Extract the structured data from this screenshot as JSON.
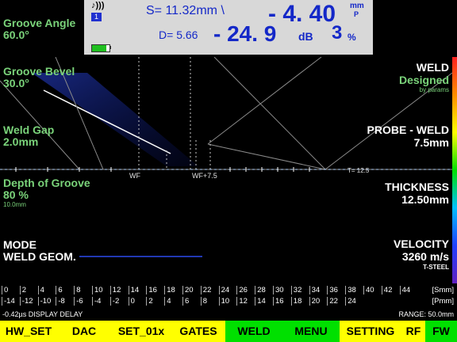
{
  "top": {
    "param_title": "Groove Angle",
    "param_value": "60.0°",
    "mode_badge": "1",
    "s_label": "S=",
    "s_value": "11.32mm",
    "s_glyph": "\\",
    "d_label": "D=",
    "d_value": "5.66",
    "depth_value": "- 4. 40",
    "depth_unit_top": "mm",
    "depth_unit_bottom": "P",
    "amp_value": "- 24. 9",
    "amp_unit": "dB",
    "pct_value": "3",
    "pct_unit": "%",
    "battery_level": 0.8
  },
  "left": {
    "groove_bevel_title": "Groove Bevel",
    "groove_bevel_value": "30.0°",
    "weld_gap_title": "Weld Gap",
    "weld_gap_value": " 2.0mm",
    "depth_title": "Depth of Groove",
    "depth_value": "80 %",
    "depth_sub": "10.0mm",
    "mode_title": "MODE",
    "mode_value": "WELD GEOM."
  },
  "right": {
    "weld_title": "WELD",
    "weld_value": "Designed",
    "weld_sub": "by params",
    "probe_title": "PROBE - WELD",
    "probe_value": "7.5mm",
    "thickness_title": "THICKNESS",
    "thickness_value": "12.50mm",
    "velocity_title": "VELOCITY",
    "velocity_value": "3260 m/s",
    "velocity_sub": "T-STEEL"
  },
  "plot": {
    "wf_label": "WF",
    "wf2_label": "WF+7.5",
    "t_label": "T= 12.5"
  },
  "scale": {
    "smm_ticks": [
      "0",
      "2",
      "4",
      "6",
      "8",
      "10",
      "12",
      "14",
      "16",
      "18",
      "20",
      "22",
      "24",
      "26",
      "28",
      "30",
      "32",
      "34",
      "36",
      "38",
      "40",
      "42",
      "44"
    ],
    "smm_unit": "[Smm]",
    "pmm_ticks": [
      "-14",
      "-12",
      "-10",
      "-8",
      "-6",
      "-4",
      "-2",
      "0",
      "2",
      "4",
      "6",
      "8",
      "10",
      "12",
      "14",
      "16",
      "18",
      "20",
      "22",
      "24"
    ],
    "pmm_unit": "[Pmm]"
  },
  "status": {
    "delay": "-0.42µs  DISPLAY DELAY",
    "range": "RANGE:  50.0mm"
  },
  "menu": {
    "items": [
      "HW_SET",
      "DAC",
      "SET_01x",
      "GATES",
      "WELD",
      "MENU",
      "SETTING",
      "RF",
      "FW"
    ],
    "menu_bg": "#ffff00",
    "selected_bg": "#00e000"
  }
}
